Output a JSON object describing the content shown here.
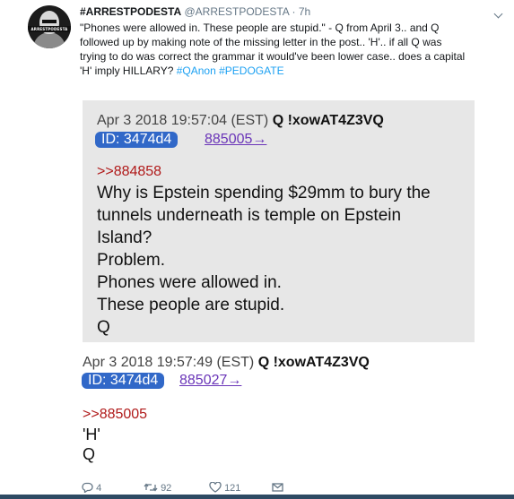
{
  "tweet": {
    "author": "#ARRESTPODESTA",
    "handle": "@ARRESTPODESTA",
    "separator": " · ",
    "time": "7h",
    "avatar_text": "ARRESTPODESTA",
    "lines": [
      "\"Phones were allowed in. These people are stupid.\" - Q from April 3.. and Q",
      "followed up by making note of the missing letter in the post.. 'H'.. if all Q was",
      "trying to do was correct the grammar it would've been lower case.. does a capital",
      "'H' imply HILLARY? "
    ],
    "hashtags": [
      "#QAnon",
      "#PEDOGATE"
    ]
  },
  "post1": {
    "date": "Apr 3 2018 19:57:04 (EST)",
    "trip": "Q !xowAT4Z3VQ",
    "id": "ID: 3474d4",
    "link": "885005→",
    "reply_to": ">>884858",
    "body": [
      "Why is Epstein spending $29mm to bury the",
      "tunnels underneath is temple on Epstein",
      "Island?",
      "Problem.",
      "Phones were allowed in.",
      "These people are stupid.",
      "Q"
    ]
  },
  "post2": {
    "date": "Apr 3 2018 19:57:49 (EST)",
    "trip": "Q !xowAT4Z3VQ",
    "id": "ID: 3474d4",
    "link": "885027→",
    "reply_to": ">>885005",
    "body": [
      "'H'",
      "Q"
    ]
  },
  "actions": {
    "replies": "4",
    "retweets": "92",
    "likes": "121"
  },
  "colors": {
    "link_blue": "#1da1f2",
    "id_pill": "#3168c8",
    "post_link": "#6a35b8",
    "reply_red": "#b01a1a"
  }
}
